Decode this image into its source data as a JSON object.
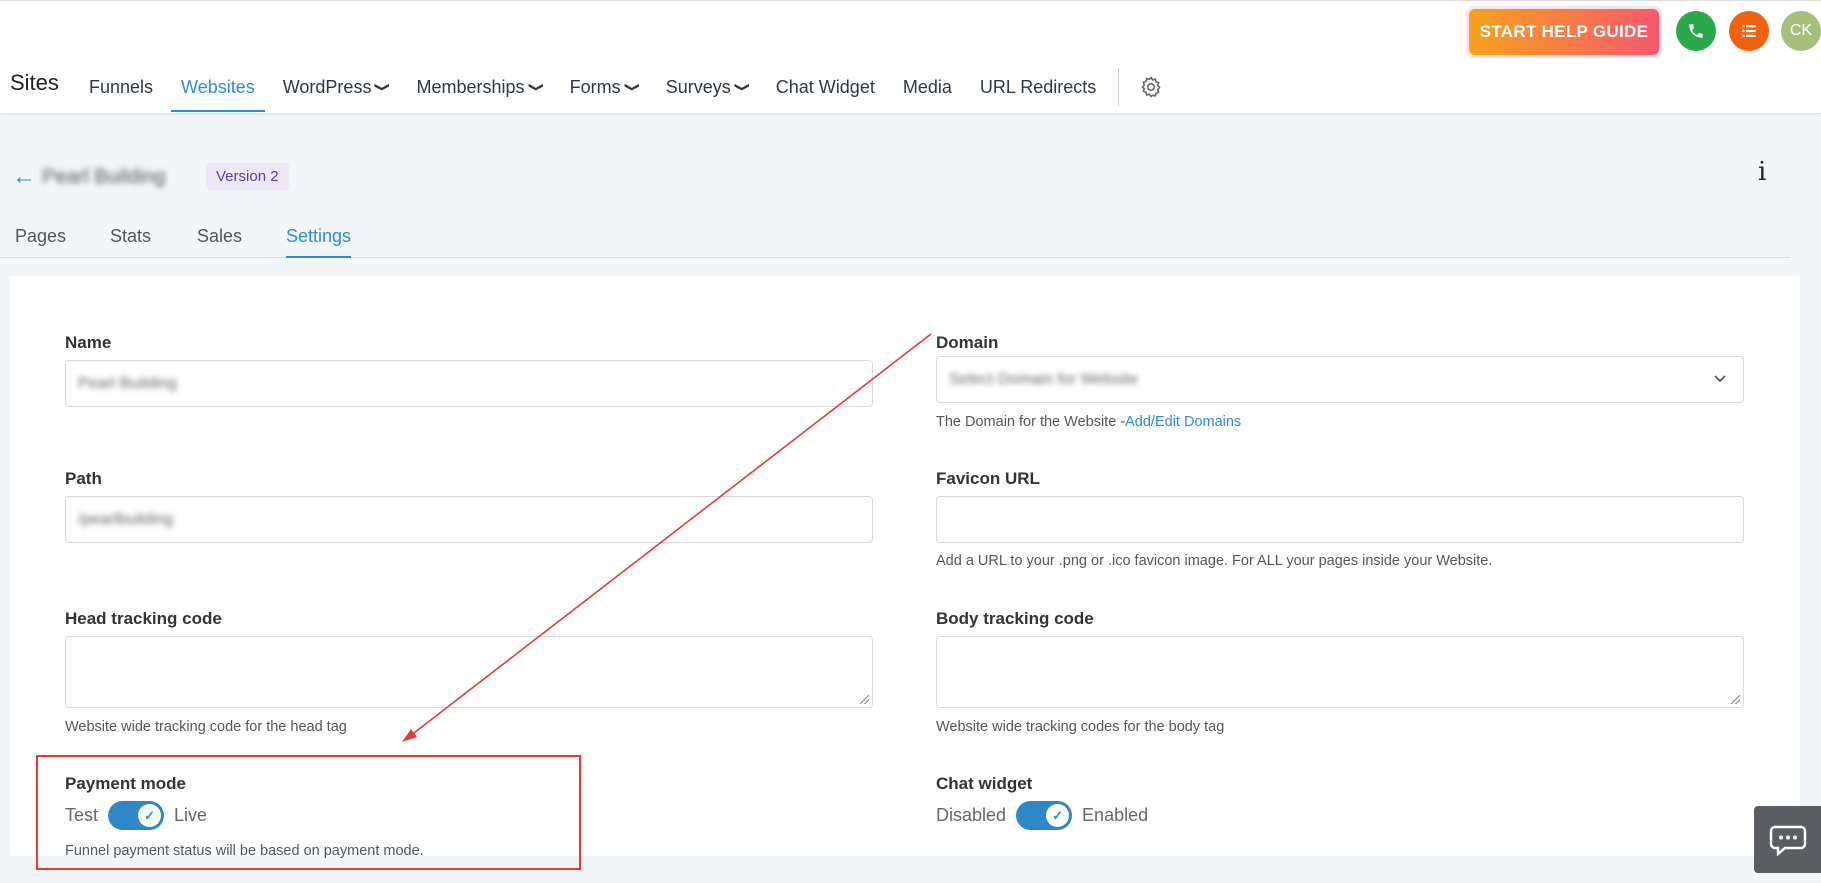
{
  "header": {
    "help_button": "START HELP GUIDE",
    "avatar_initials": "CK",
    "app_title": "Sites",
    "nav": [
      {
        "label": "Funnels",
        "dropdown": false,
        "active": false
      },
      {
        "label": "Websites",
        "dropdown": false,
        "active": true
      },
      {
        "label": "WordPress",
        "dropdown": true,
        "active": false
      },
      {
        "label": "Memberships",
        "dropdown": true,
        "active": false
      },
      {
        "label": "Forms",
        "dropdown": true,
        "active": false
      },
      {
        "label": "Surveys",
        "dropdown": true,
        "active": false
      },
      {
        "label": "Chat Widget",
        "dropdown": false,
        "active": false
      },
      {
        "label": "Media",
        "dropdown": false,
        "active": false
      },
      {
        "label": "URL Redirects",
        "dropdown": false,
        "active": false
      }
    ],
    "icons": {
      "phone": "phone-icon",
      "list": "list-icon",
      "settings": "gear-icon"
    }
  },
  "breadcrumb": {
    "site_name": "Pearl Building",
    "version_badge": "Version 2",
    "info": "i"
  },
  "subtabs": [
    "Pages",
    "Stats",
    "Sales",
    "Settings"
  ],
  "active_subtab": "Settings",
  "settings": {
    "name": {
      "label": "Name",
      "value": "Pearl Building"
    },
    "domain": {
      "label": "Domain",
      "placeholder": "Select Domain for Website",
      "help": "The Domain for the Website -",
      "help_link": "Add/Edit Domains"
    },
    "path": {
      "label": "Path",
      "value": "/pearlbuilding"
    },
    "favicon": {
      "label": "Favicon URL",
      "value": "",
      "help": "Add a URL to your .png or .ico favicon image. For ALL your pages inside your Website."
    },
    "head_tracking": {
      "label": "Head tracking code",
      "value": "",
      "help": "Website wide tracking code for the head tag"
    },
    "body_tracking": {
      "label": "Body tracking code",
      "value": "",
      "help": "Website wide tracking codes for the body tag"
    },
    "payment_mode": {
      "label": "Payment mode",
      "off_label": "Test",
      "on_label": "Live",
      "enabled": true,
      "help": "Funnel payment status will be based on payment mode."
    },
    "chat_widget": {
      "label": "Chat widget",
      "off_label": "Disabled",
      "on_label": "Enabled",
      "enabled": true
    }
  },
  "annotation": {
    "color": "#e23a3a"
  },
  "colors": {
    "accent": "#2c8bdc",
    "toggle": "#2f86c9",
    "help_gradient_start": "#f7a21b",
    "help_gradient_end": "#f7586f"
  }
}
